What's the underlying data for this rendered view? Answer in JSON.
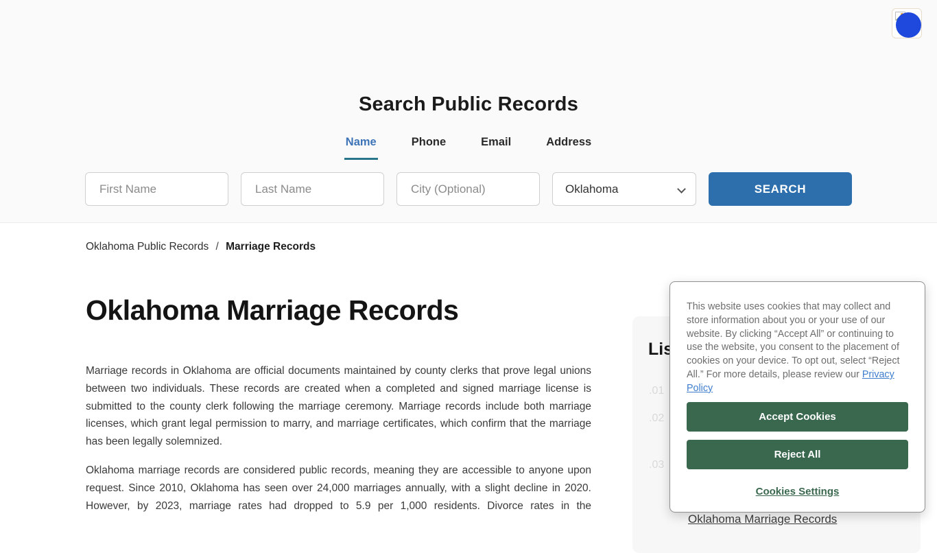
{
  "search_section": {
    "title": "Search Public Records",
    "tabs": [
      {
        "label": "Name",
        "active": true
      },
      {
        "label": "Phone",
        "active": false
      },
      {
        "label": "Email",
        "active": false
      },
      {
        "label": "Address",
        "active": false
      }
    ],
    "form": {
      "first_name_placeholder": "First Name",
      "last_name_placeholder": "Last Name",
      "city_placeholder": "City (Optional)",
      "state_selected": "Oklahoma",
      "search_button_label": "SEARCH"
    }
  },
  "breadcrumb": {
    "parent": "Oklahoma Public Records",
    "separator": "/",
    "current": "Marriage Records"
  },
  "article": {
    "title": "Oklahoma Marriage Records",
    "paragraphs": [
      "Marriage records in Oklahoma are official documents maintained by county clerks that prove legal unions between two individuals. These records are created when a completed and signed marriage license is submitted to the county clerk following the marriage ceremony. Marriage records include both marriage licenses, which grant legal permission to marry, and marriage certificates, which confirm that the marriage has been legally solemnized.",
      "Oklahoma marriage records are considered public records, meaning they are accessible to anyone upon request. Since 2010, Oklahoma has seen over 24,000 marriages annually, with a slight decline in 2020. However, by 2023, marriage rates had dropped to 5.9 per 1,000 residents. Divorce rates in the"
    ]
  },
  "sidebar": {
    "heading_visible": "Lis",
    "item_numbers": [
      ".01",
      ".02",
      ".03"
    ],
    "visible_link": "Oklahoma Marriage Records"
  },
  "cookie_dialog": {
    "message": "This website uses cookies that may collect and store information about you or your use of our website. By clicking “Accept All” or continuing to use the website, you consent to the placement of cookies on your device. To opt out, select “Reject All.” For more details, please review our ",
    "privacy_policy_label": "Privacy Policy",
    "accept_label": "Accept Cookies",
    "reject_label": "Reject All",
    "settings_label": "Cookies Settings"
  },
  "colors": {
    "tab_active": "#3d74b8",
    "tab_underline": "#27768a",
    "search_button": "#2d6fad",
    "cookie_button_green": "#3a684e",
    "privacy_link_blue": "#3e7dce",
    "hero_background": "#fafafa",
    "toc_card_background": "#f7f7f7"
  }
}
